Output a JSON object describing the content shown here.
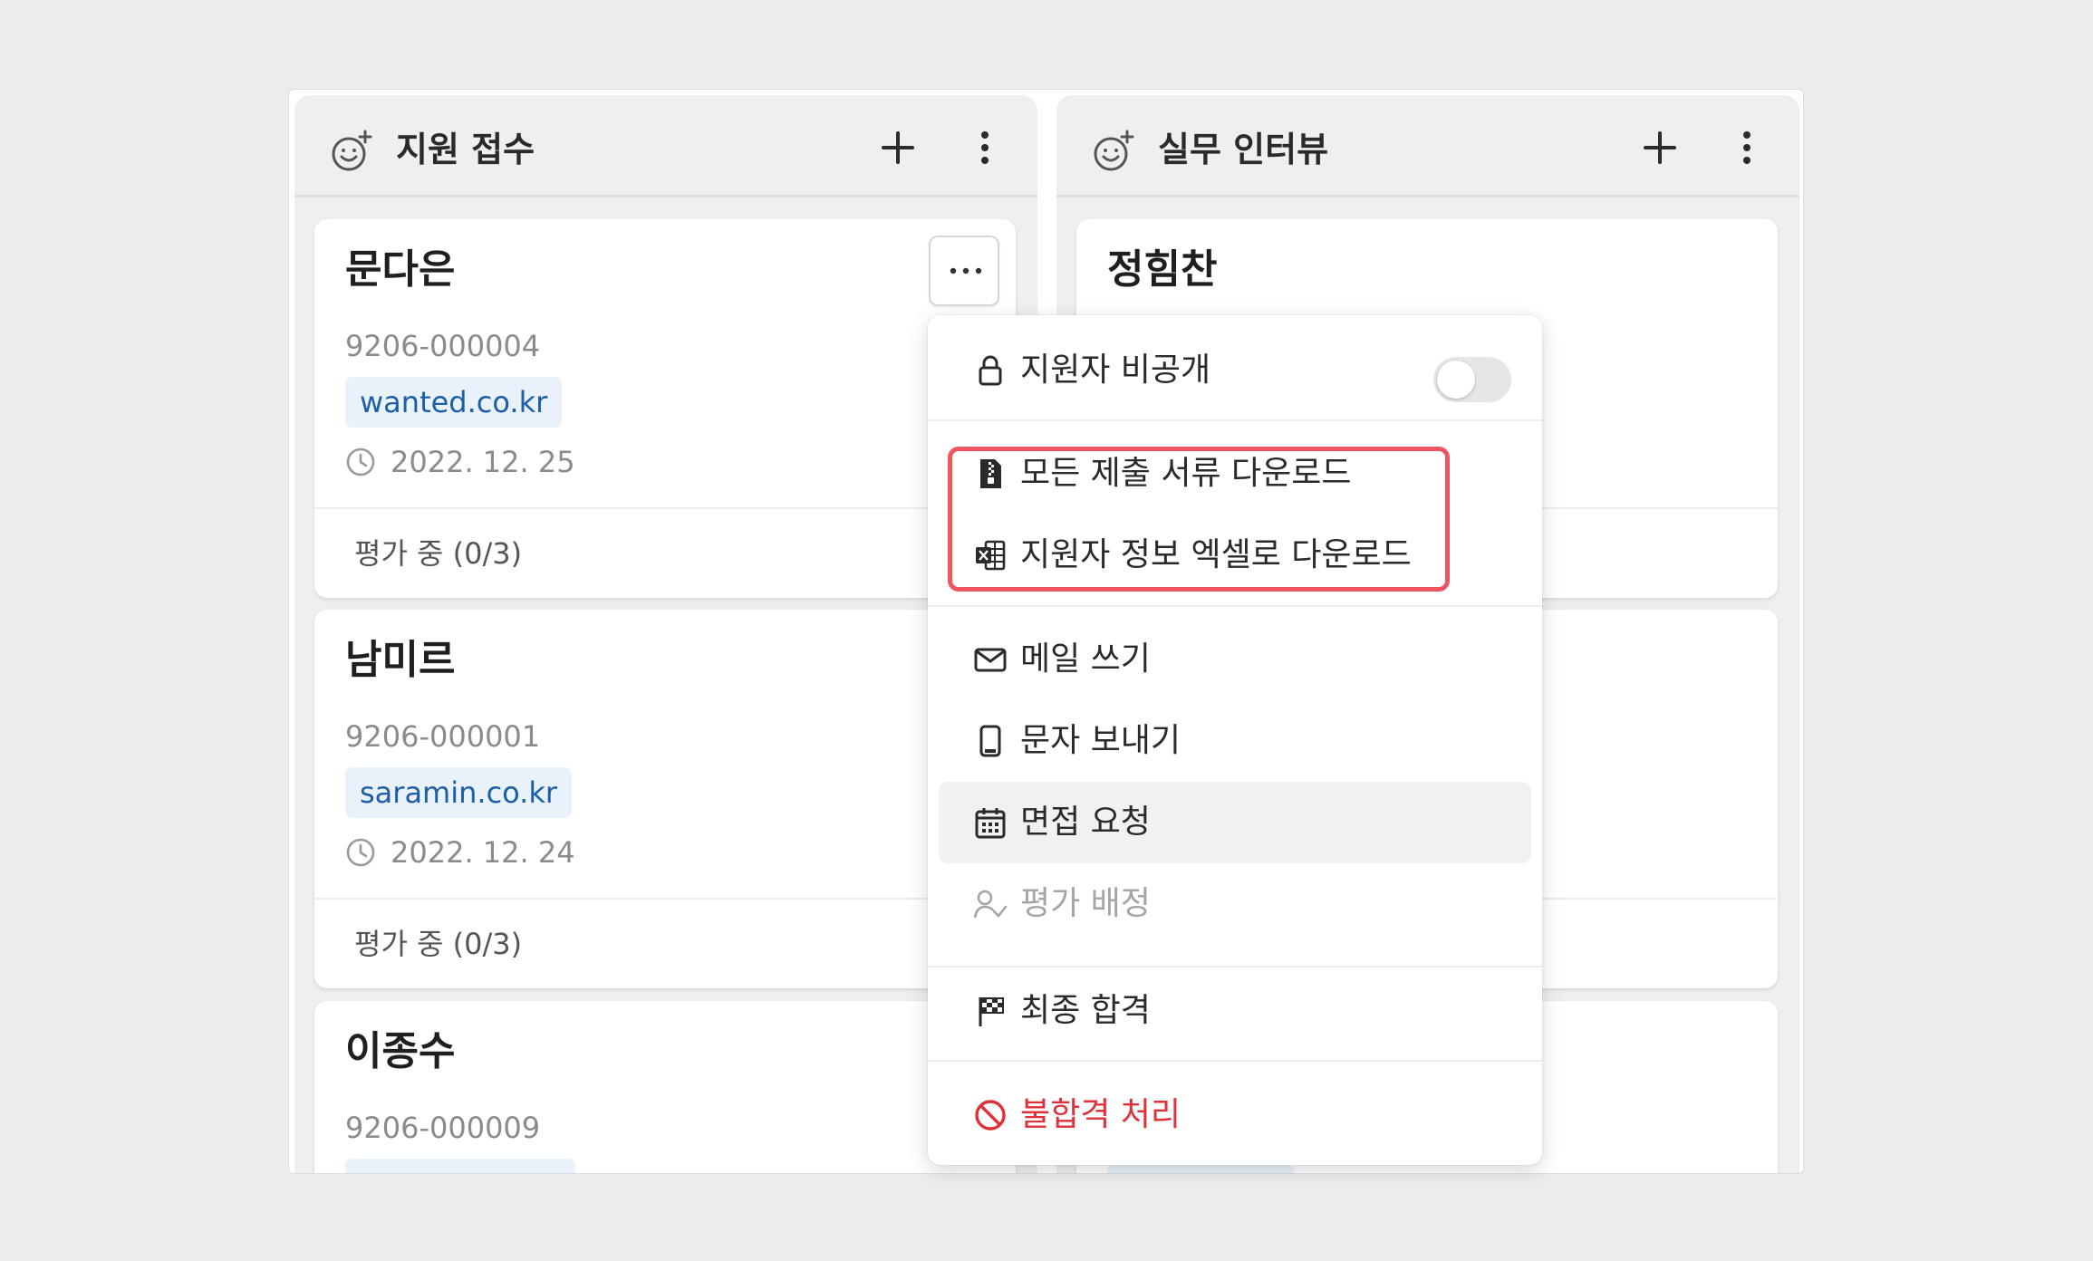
{
  "columns": [
    {
      "title": "지원 접수",
      "cards": [
        {
          "name": "문다은",
          "id": "9206-000004",
          "source": "wanted.co.kr",
          "date": "2022. 12. 25",
          "status": "평가 중 (0/3)"
        },
        {
          "name": "남미르",
          "id": "9206-000001",
          "source": "saramin.co.kr",
          "date": "2022. 12. 24",
          "status": "평가 중 (0/3)"
        },
        {
          "name": "이종수",
          "id": "9206-000009"
        }
      ]
    },
    {
      "title": "실무 인터뷰",
      "cards": [
        {
          "name": "정힘찬"
        }
      ]
    }
  ],
  "menu": {
    "private": {
      "label": "지원자 비공개",
      "icon": "lock-icon",
      "enabled": false
    },
    "download_docs": {
      "label": "모든 제출 서류 다운로드",
      "icon": "document-zip-icon"
    },
    "download_excel": {
      "label": "지원자 정보 엑셀로 다운로드",
      "icon": "excel-icon"
    },
    "send_mail": {
      "label": "메일 쓰기",
      "icon": "mail-icon"
    },
    "send_sms": {
      "label": "문자 보내기",
      "icon": "phone-icon"
    },
    "request_interview": {
      "label": "면접 요청",
      "icon": "calendar-icon"
    },
    "assign_eval": {
      "label": "평가 배정",
      "icon": "user-check-icon"
    },
    "final_pass": {
      "label": "최종 합격",
      "icon": "finish-flag-icon"
    },
    "reject": {
      "label": "불합격 처리",
      "icon": "block-icon"
    }
  },
  "colors": {
    "accent_link": "#1d5ea8",
    "tag_bg": "#e9f1fa",
    "danger": "#e0303a",
    "highlight": "#ee5560"
  }
}
